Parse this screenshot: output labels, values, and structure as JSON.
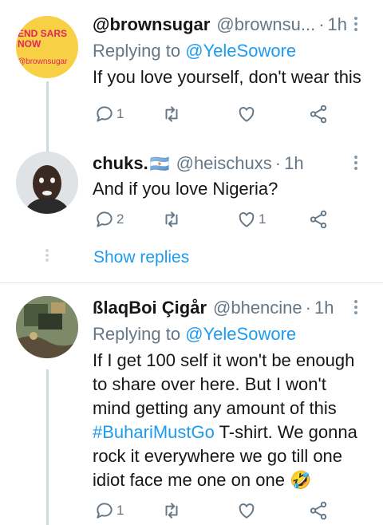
{
  "tweets": [
    {
      "name": "@brownsugar",
      "handle": "@brownsu...",
      "time": "1h",
      "reply_prefix": "Replying to ",
      "reply_to": "@YeleSowore",
      "text": "If you love yourself, don't wear this",
      "avatar_text_1": "END SARS",
      "avatar_text_2": "NOW",
      "avatar_text_3": "@brownsugar",
      "reply_count": "1",
      "retweet_count": "",
      "like_count": ""
    },
    {
      "name": "chuks.",
      "flag_glyph": "🇦🇷",
      "handle": "@heischuxs",
      "time": "1h",
      "text": "And if you love Nigeria?",
      "reply_count": "2",
      "retweet_count": "",
      "like_count": "1"
    },
    {
      "name": "ßlaqBoi Çigår",
      "handle": "@bhencine",
      "time": "1h",
      "reply_prefix": "Replying to ",
      "reply_to": "@YeleSowore",
      "text_1": "If I get 100 self it won't be enough to share over here. But I won't mind getting any amount of this ",
      "hashtag": "#BuhariMustGo",
      "text_2": " T-shirt. We gonna rock it everywhere we go till one idiot face me one on one ",
      "emoji": "🤣",
      "reply_count": "1",
      "retweet_count": "",
      "like_count": ""
    }
  ],
  "show_replies_label": "Show replies",
  "dot_separator": "·",
  "colors": {
    "accent": "#1d9bf0",
    "muted": "#657786",
    "avatar1_bg": "#f7d046",
    "avatar1_text": "#e0245e"
  }
}
